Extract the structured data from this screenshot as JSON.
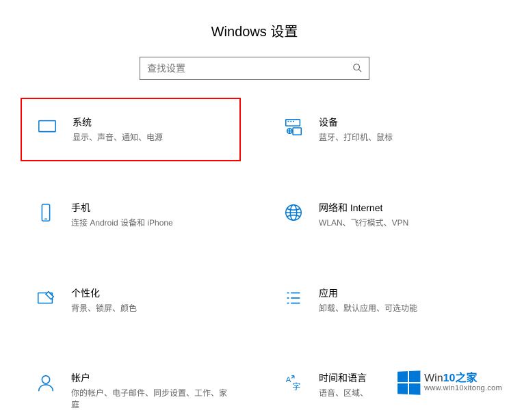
{
  "title": "Windows 设置",
  "search": {
    "placeholder": "查找设置"
  },
  "tiles": {
    "system": {
      "title": "系统",
      "desc": "显示、声音、通知、电源"
    },
    "devices": {
      "title": "设备",
      "desc": "蓝牙、打印机、鼠标"
    },
    "phone": {
      "title": "手机",
      "desc": "连接 Android 设备和 iPhone"
    },
    "network": {
      "title": "网络和 Internet",
      "desc": "WLAN、飞行模式、VPN"
    },
    "personal": {
      "title": "个性化",
      "desc": "背景、锁屏、颜色"
    },
    "apps": {
      "title": "应用",
      "desc": "卸载、默认应用、可选功能"
    },
    "accounts": {
      "title": "帐户",
      "desc": "你的帐户、电子邮件、同步设置、工作、家庭"
    },
    "time": {
      "title": "时间和语言",
      "desc": "语音、区域、"
    }
  },
  "watermark": {
    "brand": "Win",
    "num": "10",
    "zh": "之家",
    "url": "www.win10xitong.com"
  }
}
